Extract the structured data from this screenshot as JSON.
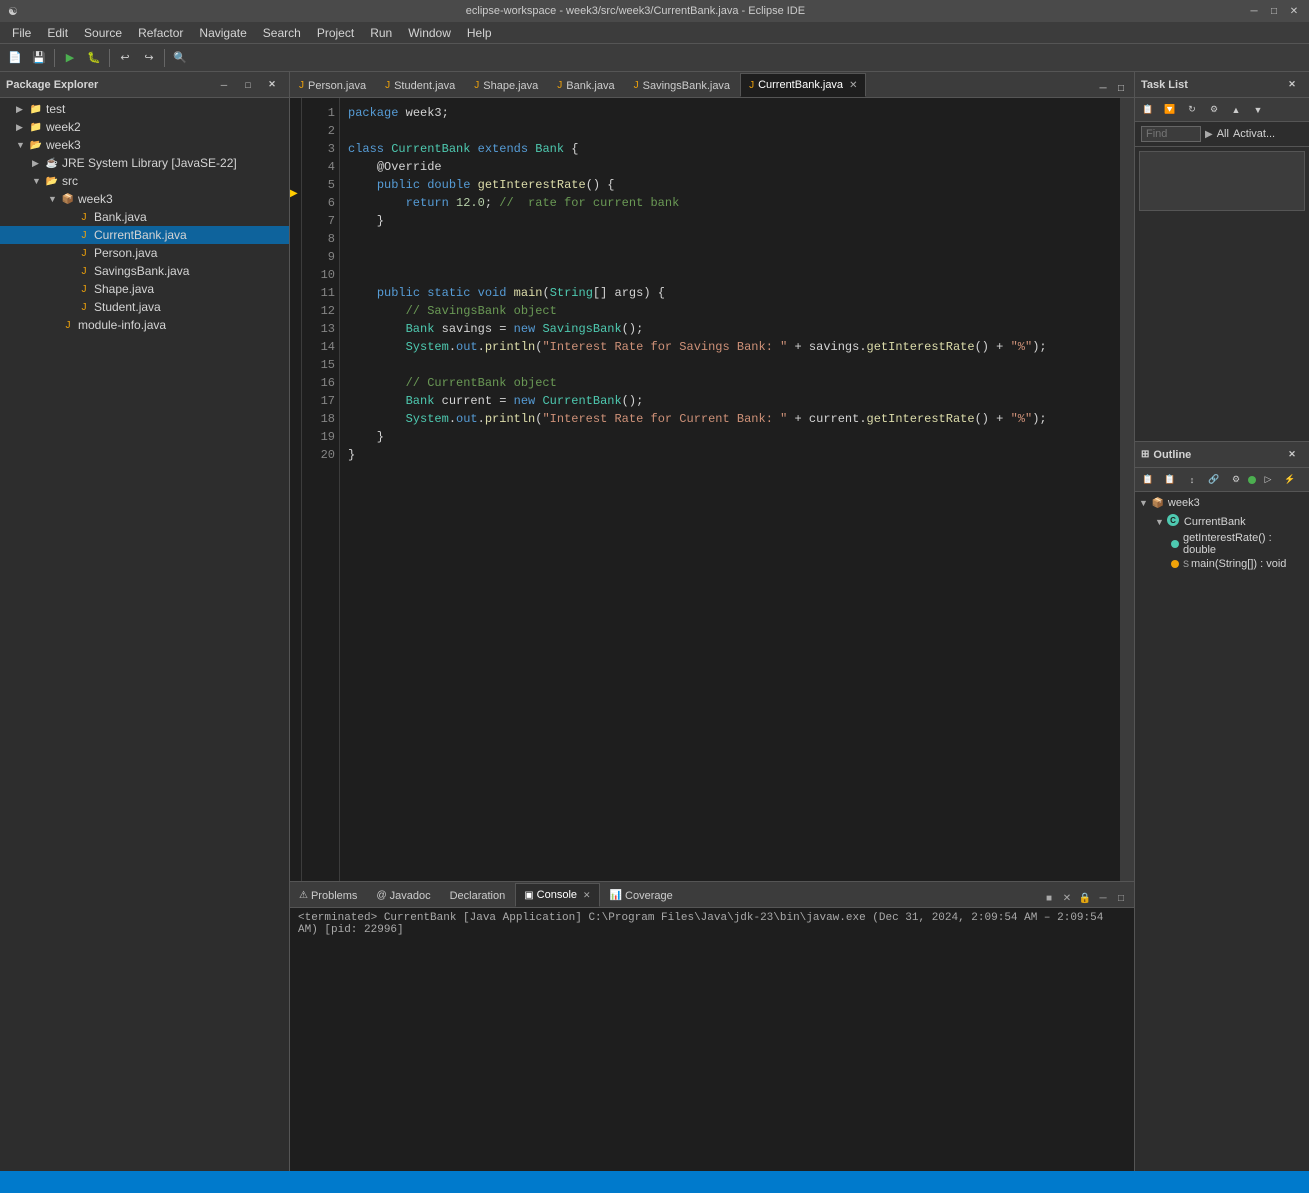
{
  "titlebar": {
    "title": "eclipse-workspace - week3/src/week3/CurrentBank.java - Eclipse IDE",
    "logo": "☯",
    "minimize": "─",
    "maximize": "□",
    "close": "✕"
  },
  "menubar": {
    "items": [
      "File",
      "Edit",
      "Source",
      "Refactor",
      "Navigate",
      "Search",
      "Project",
      "Run",
      "Window",
      "Help"
    ]
  },
  "package_explorer": {
    "title": "Package Explorer",
    "close": "✕",
    "tree": [
      {
        "id": "test",
        "label": "test",
        "level": 0,
        "expanded": false,
        "type": "folder"
      },
      {
        "id": "week2",
        "label": "week2",
        "level": 0,
        "expanded": false,
        "type": "folder"
      },
      {
        "id": "week3",
        "label": "week3",
        "level": 0,
        "expanded": true,
        "type": "folder"
      },
      {
        "id": "jre",
        "label": "JRE System Library [JavaSE-22]",
        "level": 1,
        "expanded": false,
        "type": "jar"
      },
      {
        "id": "src",
        "label": "src",
        "level": 1,
        "expanded": true,
        "type": "folder"
      },
      {
        "id": "week3pkg",
        "label": "week3",
        "level": 2,
        "expanded": true,
        "type": "package"
      },
      {
        "id": "bankjava",
        "label": "Bank.java",
        "level": 3,
        "expanded": false,
        "type": "java"
      },
      {
        "id": "currentbankjava",
        "label": "CurrentBank.java",
        "level": 3,
        "expanded": false,
        "type": "java",
        "selected": true
      },
      {
        "id": "personjava",
        "label": "Person.java",
        "level": 3,
        "expanded": false,
        "type": "java"
      },
      {
        "id": "savingsbankjava",
        "label": "SavingsBank.java",
        "level": 3,
        "expanded": false,
        "type": "java"
      },
      {
        "id": "shapejava",
        "label": "Shape.java",
        "level": 3,
        "expanded": false,
        "type": "java"
      },
      {
        "id": "studentjava",
        "label": "Student.java",
        "level": 3,
        "expanded": false,
        "type": "java"
      },
      {
        "id": "moduleinfo",
        "label": "module-info.java",
        "level": 2,
        "expanded": false,
        "type": "java"
      }
    ]
  },
  "tabs": [
    {
      "id": "personjava",
      "label": "Person.java",
      "active": false,
      "closable": false
    },
    {
      "id": "studentjava",
      "label": "Student.java",
      "active": false,
      "closable": false
    },
    {
      "id": "shapejava",
      "label": "Shape.java",
      "active": false,
      "closable": false
    },
    {
      "id": "bankjava",
      "label": "Bank.java",
      "active": false,
      "closable": false
    },
    {
      "id": "savingsbankjava",
      "label": "SavingsBank.java",
      "active": false,
      "closable": false
    },
    {
      "id": "currentbankjava",
      "label": "CurrentBank.java",
      "active": true,
      "closable": true
    }
  ],
  "code": {
    "filename": "CurrentBank.java",
    "lines": [
      {
        "num": 1,
        "text": "package week3;"
      },
      {
        "num": 2,
        "text": ""
      },
      {
        "num": 3,
        "text": "class CurrentBank extends Bank {"
      },
      {
        "num": 4,
        "text": "    @Override"
      },
      {
        "num": 5,
        "text": "    public double getInterestRate() {"
      },
      {
        "num": 6,
        "text": "        return 12.0; //  rate for current bank"
      },
      {
        "num": 7,
        "text": "    }"
      },
      {
        "num": 8,
        "text": ""
      },
      {
        "num": 9,
        "text": ""
      },
      {
        "num": 10,
        "text": ""
      },
      {
        "num": 11,
        "text": "    public static void main(String[] args) {"
      },
      {
        "num": 12,
        "text": "        // SavingsBank object"
      },
      {
        "num": 13,
        "text": "        Bank savings = new SavingsBank();"
      },
      {
        "num": 14,
        "text": "        System.out.println(\"Interest Rate for Savings Bank: \" + savings.getInterestRate() + \"%\");"
      },
      {
        "num": 15,
        "text": ""
      },
      {
        "num": 16,
        "text": "        // CurrentBank object"
      },
      {
        "num": 17,
        "text": "        Bank current = new CurrentBank();"
      },
      {
        "num": 18,
        "text": "        System.out.println(\"Interest Rate for Current Bank: \" + current.getInterestRate() + \"%\");"
      },
      {
        "num": 19,
        "text": "    }"
      },
      {
        "num": 20,
        "text": "}"
      }
    ]
  },
  "task_list": {
    "title": "Task List",
    "close": "✕"
  },
  "outline": {
    "title": "Outline",
    "close": "✕",
    "find_placeholder": "Find",
    "all_label": "All",
    "activate_label": "Activat...",
    "items": [
      {
        "id": "week3pkg",
        "label": "week3",
        "level": 0,
        "type": "package",
        "expanded": true
      },
      {
        "id": "currentbank_class",
        "label": "CurrentBank",
        "level": 1,
        "type": "class",
        "expanded": true
      },
      {
        "id": "getinterestrate",
        "label": "getInterestRate() : double",
        "level": 2,
        "type": "method"
      },
      {
        "id": "mainmethod",
        "label": "main(String[]) : void",
        "level": 2,
        "type": "static_method"
      }
    ]
  },
  "bottom_tabs": [
    {
      "id": "problems",
      "label": "Problems",
      "active": false,
      "closable": false
    },
    {
      "id": "javadoc",
      "label": "Javadoc",
      "active": false,
      "closable": false
    },
    {
      "id": "declaration",
      "label": "Declaration",
      "active": false,
      "closable": false
    },
    {
      "id": "console",
      "label": "Console",
      "active": true,
      "closable": true
    },
    {
      "id": "coverage",
      "label": "Coverage",
      "active": false,
      "closable": false
    }
  ],
  "console": {
    "terminated_text": "<terminated> CurrentBank [Java Application] C:\\Program Files\\Java\\jdk-23\\bin\\javaw.exe (Dec 31, 2024, 2:09:54 AM – 2:09:54 AM) [pid: 22996]"
  },
  "statusbar": {
    "items": [
      "",
      "",
      ""
    ]
  }
}
